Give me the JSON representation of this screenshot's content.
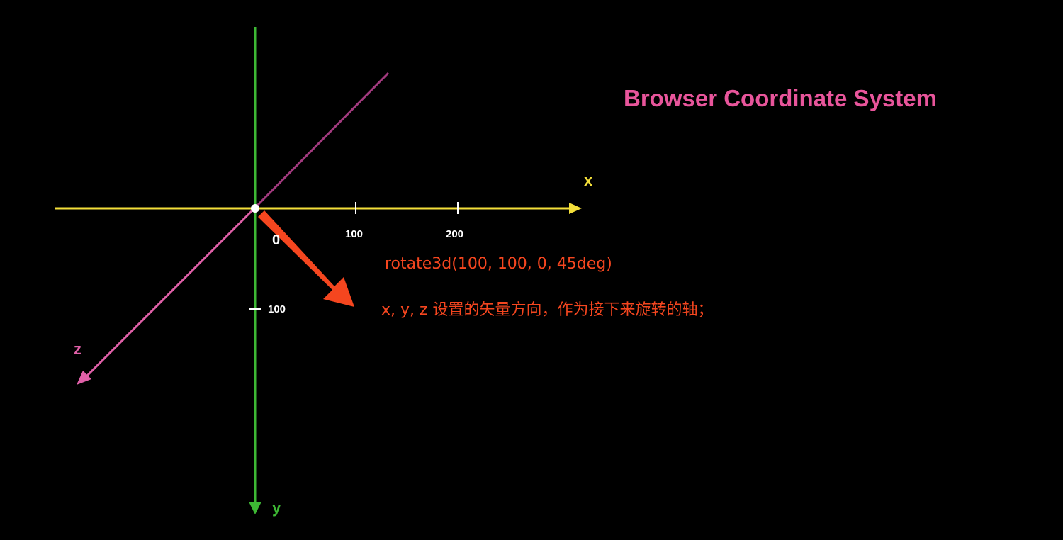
{
  "title": "Browser Coordinate System",
  "axes": {
    "x": {
      "label": "x",
      "color": "#F4DF3A"
    },
    "y": {
      "label": "y",
      "color": "#3DB834"
    },
    "z": {
      "label": "z",
      "color": "#E060A8"
    }
  },
  "origin_label": "0",
  "ticks": {
    "x": [
      "100",
      "200"
    ],
    "y": [
      "100"
    ]
  },
  "annotation": {
    "line1": "rotate3d(100, 100, 0, 45deg)",
    "line2": "x, y, z 设置的矢量方向，作为接下来旋转的轴；",
    "arrow_color": "#F5461F"
  },
  "diagonal_line_color": "#A23A7E"
}
